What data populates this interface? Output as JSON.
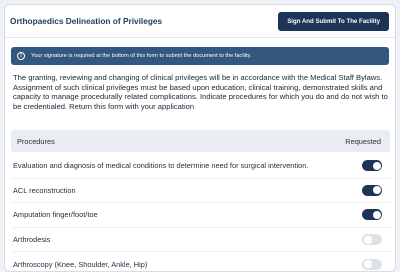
{
  "header": {
    "title": "Orthopaedics Delineation of Privileges",
    "submit_label": "Sign And Submit To The Facility"
  },
  "alert": {
    "icon": "info-icon",
    "icon_glyph": "!",
    "text": "Your signature is required at the bottom of this form to submit the document to the facility."
  },
  "intro": "The granting, reviewing and changing of clinical privileges will be in accordance with the Medical Staff Bylaws. Assignment of such clinical privileges must be based upon education, clinical training, demonstrated skills and capacity to manage procedurally related complications. Indicate procedures for which you do and do not wish to be credentialed. Return this form with your application",
  "table": {
    "columns": [
      "Procedures",
      "Requested"
    ],
    "rows": [
      {
        "label": "Evaluation and diagnosis of medical conditions to determine need for surgical intervention.",
        "requested": true
      },
      {
        "label": "ACL reconstruction",
        "requested": true
      },
      {
        "label": "Amputation finger/foot/toe",
        "requested": true
      },
      {
        "label": "Arthrodesis",
        "requested": false
      },
      {
        "label": "Arthroscopy (Knee, Shoulder, Ankle, Hip)",
        "requested": false
      }
    ]
  },
  "colors": {
    "primary": "#1c3557",
    "alert_bg": "#33577e",
    "toggle_off": "#dde2e8"
  }
}
